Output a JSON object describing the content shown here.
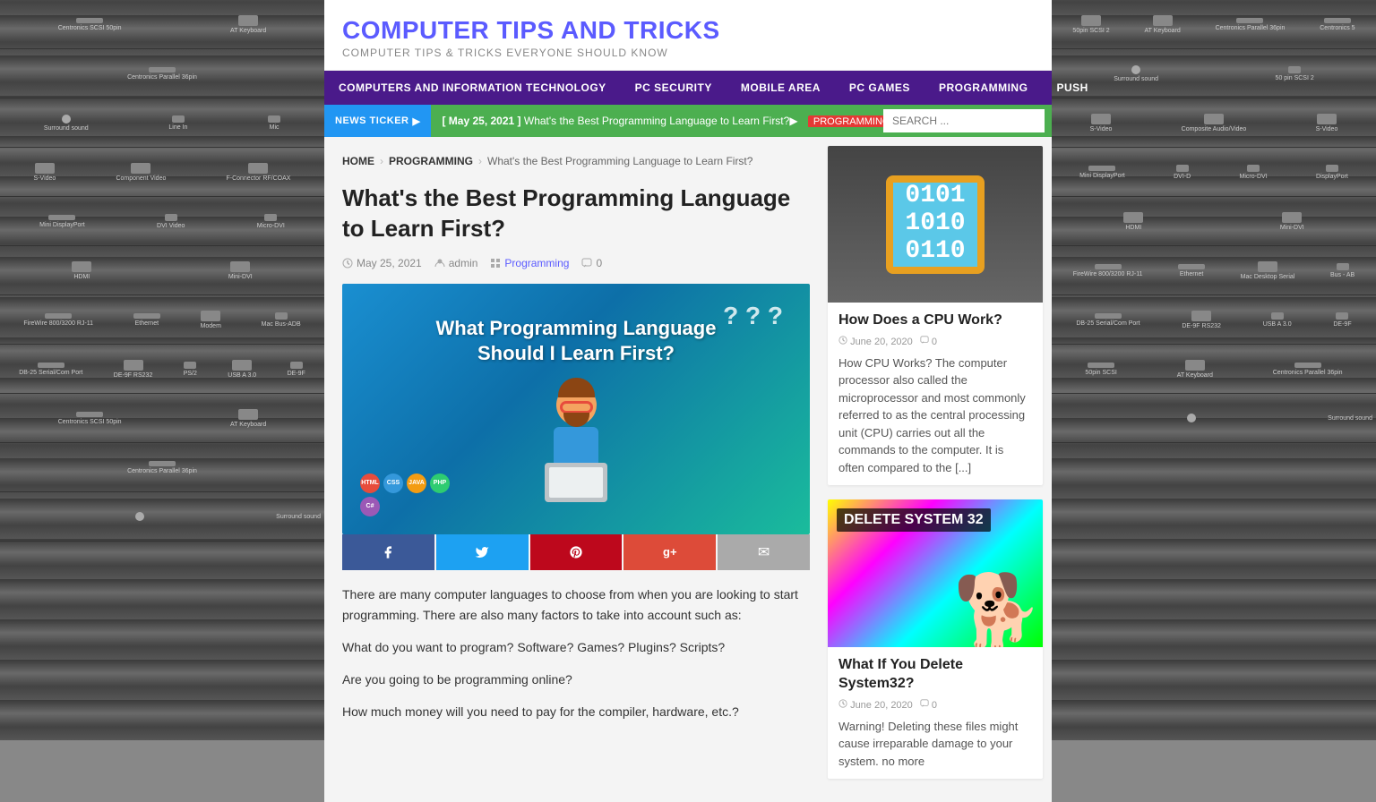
{
  "site": {
    "title": "COMPUTER TIPS AND TRICKS",
    "subtitle": "COMPUTER TIPS & TRICKS EVERYONE SHOULD KNOW"
  },
  "nav": {
    "items": [
      {
        "label": "COMPUTERS AND INFORMATION TECHNOLOGY",
        "href": "#"
      },
      {
        "label": "PC SECURITY",
        "href": "#"
      },
      {
        "label": "MOBILE AREA",
        "href": "#"
      },
      {
        "label": "PC GAMES",
        "href": "#"
      },
      {
        "label": "PROGRAMMING",
        "href": "#"
      },
      {
        "label": "PUSH",
        "href": "#"
      }
    ]
  },
  "ticker": {
    "label": "NEWS TICKER",
    "date": "[ May 25, 2021 ]",
    "text": "What's the Best Programming Language to Learn First?",
    "tag": "PROGRAMMING",
    "search_placeholder": "SEARCH ..."
  },
  "breadcrumb": {
    "home": "HOME",
    "section": "PROGRAMMING",
    "current": "What's the Best Programming Language to Learn First?"
  },
  "article": {
    "title": "What's the Best Programming Language to Learn First?",
    "date": "May 25, 2021",
    "author": "admin",
    "category": "Programming",
    "comments": "0",
    "featured_title_line1": "What Programming Language",
    "featured_title_line2": "Should I Learn First?",
    "body_para1": "There are many computer languages to choose from when you are looking to start programming. There are also many factors to take into account such as:",
    "body_para2": "What do you want to program? Software? Games? Plugins? Scripts?",
    "body_para3": "Are you going to be programming online?",
    "body_para4": "How much money will you need to pay for the compiler, hardware, etc.?"
  },
  "share": {
    "facebook_icon": "f",
    "twitter_icon": "t",
    "pinterest_icon": "p",
    "googleplus_icon": "g+",
    "email_icon": "✉"
  },
  "sidebar": {
    "card1": {
      "title": "How Does a CPU Work?",
      "date": "June 20, 2020",
      "comments": "0",
      "chip_text": "0101\n1010\n0110",
      "text": "How CPU Works? The computer processor also called the microprocessor and most commonly referred to as the central processing unit (CPU) carries out all the commands to the computer. It is often compared to the [...]"
    },
    "card2": {
      "title": "What If You Delete System32?",
      "date": "June 20, 2020",
      "comments": "0",
      "overlay_text": "DELETE SYSTEM 32",
      "text": "Warning! Deleting these files might cause irreparable damage to your system. no more"
    }
  }
}
